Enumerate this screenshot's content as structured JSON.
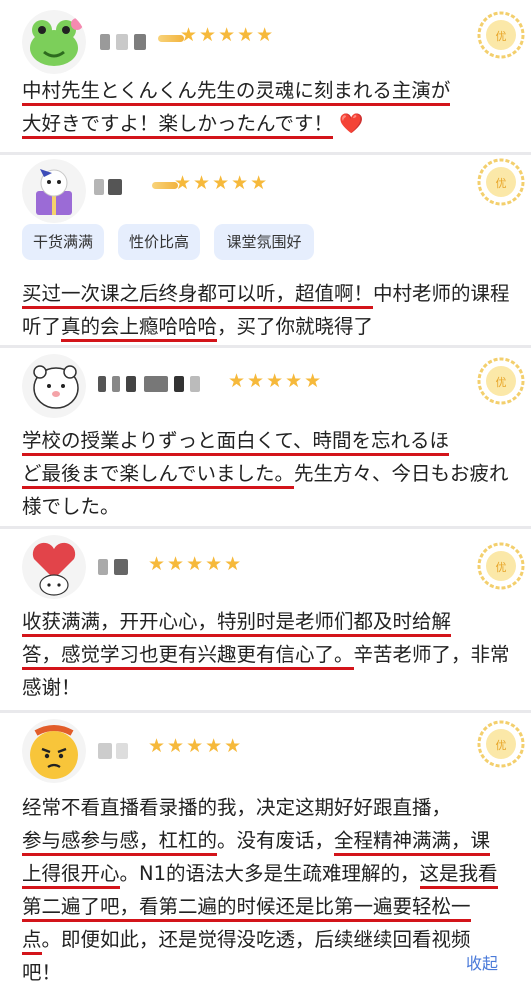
{
  "reviews": [
    {
      "stars": "★★★★★",
      "avatar_icon": "frog-emoji-icon",
      "text_parts": [
        "中村先生とくんくん先生の灵魂に刻まれる主演が",
        "大好きですよ！楽しかったんです！",
        "❤️"
      ]
    },
    {
      "stars": "★★★★★",
      "avatar_icon": "cartoon-bear-gift-icon",
      "tags": [
        "干货满满",
        "性价比高",
        "课堂氛围好"
      ],
      "text_parts": [
        "买过一次课之后终身都可以听，超值啊！",
        "中村老师的课程听了",
        "真的会上瘾哈哈哈",
        "，买了你就晓得了"
      ]
    },
    {
      "stars": "★★★★★",
      "avatar_icon": "white-bear-icon",
      "text_parts": [
        "学校の授業よりずっと面白くて、時間を忘れるほ",
        "ど最後まで楽しんでいました。",
        "先生方々、今日もお疲れ様でした。"
      ]
    },
    {
      "stars": "★★★★★",
      "avatar_icon": "heart-bear-icon",
      "text_parts": [
        "收获满满，开开心心，特别时是老师们都及时给解",
        "答，感觉学习也更有兴趣更有信心了。",
        "辛苦老师了，非常感谢！"
      ]
    },
    {
      "stars": "★★★★★",
      "avatar_icon": "angry-emoji-icon",
      "text_parts": [
        "经常不看直播看录播的我，决定这期好好跟直播，",
        "参与感参与感，杠杠的",
        "。没有废话，",
        "全程精神满满，课上得很开心",
        "。N1的语法大多是生疏难理解的，",
        "这是我看第二遍了吧，看第二遍的时候还是比第一遍要轻松一点",
        "。即便如此，还是觉得没吃透，后续继续回看视频吧！"
      ]
    }
  ],
  "badge_icon": "premium-badge-icon",
  "collapse_label": "收起",
  "colors": {
    "underline": "#d3141a",
    "star": "#f6b93b",
    "tag_bg": "#e6eefd",
    "link": "#4a7ad9"
  }
}
